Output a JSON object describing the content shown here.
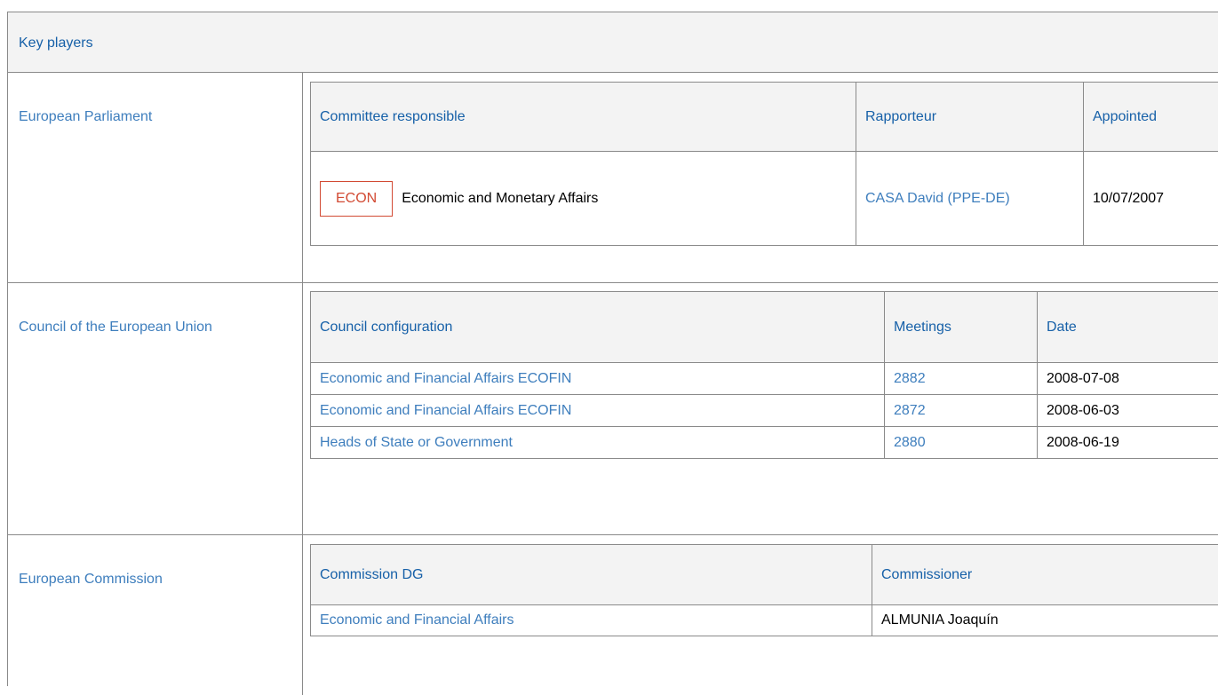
{
  "header": {
    "title": "Key players"
  },
  "parliament": {
    "label": "European Parliament",
    "columns": [
      "Committee responsible",
      "Rapporteur",
      "Appointed"
    ],
    "row": {
      "badge": "ECON",
      "committee": "Economic and Monetary Affairs",
      "rapporteur": "CASA David (PPE-DE)",
      "appointed": "10/07/2007"
    }
  },
  "council": {
    "label": "Council of the European Union",
    "columns": [
      "Council configuration",
      "Meetings",
      "Date"
    ],
    "rows": [
      {
        "configuration": "Economic and Financial Affairs ECOFIN",
        "meeting": "2882",
        "date": "2008-07-08"
      },
      {
        "configuration": "Economic and Financial Affairs ECOFIN",
        "meeting": "2872",
        "date": "2008-06-03"
      },
      {
        "configuration": "Heads of State or Government",
        "meeting": "2880",
        "date": "2008-06-19"
      }
    ]
  },
  "commission": {
    "label": "European Commission",
    "columns": [
      "Commission DG",
      "Commissioner"
    ],
    "row": {
      "dg": "Economic and Financial Affairs",
      "commissioner": "ALMUNIA Joaquín"
    }
  },
  "colors": {
    "link": "#3e7ebd",
    "header_text": "#1660a8",
    "badge": "#d24a33",
    "header_bg": "#f3f3f3",
    "border": "#8a8a8a"
  }
}
